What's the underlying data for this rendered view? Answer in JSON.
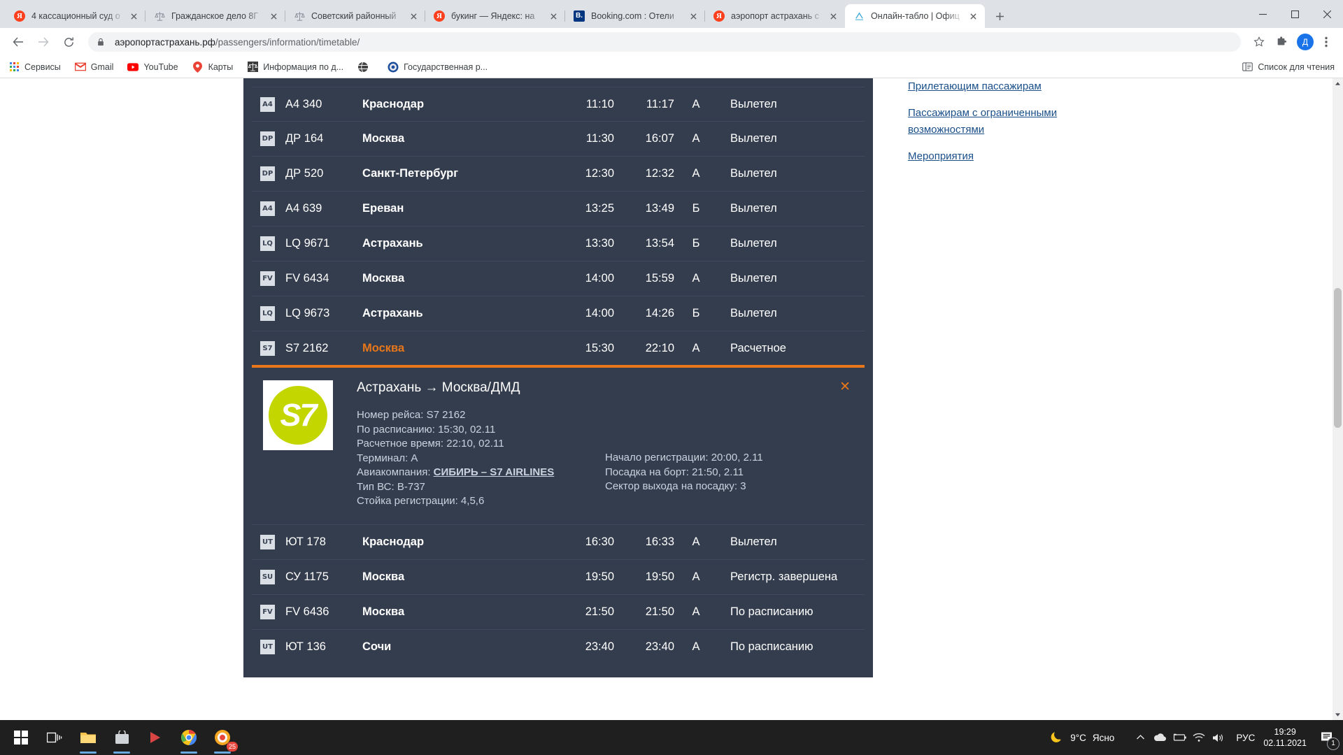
{
  "browser": {
    "tabs": [
      {
        "title": "4 кассационный суд о",
        "favicon": "yandex-icon",
        "active": false
      },
      {
        "title": "Гражданское дело 8Г",
        "favicon": "scales-icon",
        "active": false
      },
      {
        "title": "Советский районный",
        "favicon": "scales-icon",
        "active": false
      },
      {
        "title": "букинг — Яндекс: на",
        "favicon": "yandex-icon",
        "active": false
      },
      {
        "title": "Booking.com : Отели",
        "favicon": "booking-icon",
        "active": false
      },
      {
        "title": "аэропорт астрахань с",
        "favicon": "yandex-icon",
        "active": false
      },
      {
        "title": "Онлайн-табло | Офиц",
        "favicon": "airport-logo-icon",
        "active": true
      }
    ],
    "address": {
      "scheme_host": "аэропортастрахань.рф",
      "path": "/passengers/information/timetable/"
    },
    "bookmarks": [
      {
        "label": "Сервисы",
        "icon": "apps-grid-icon"
      },
      {
        "label": "Gmail",
        "icon": "gmail-icon"
      },
      {
        "label": "YouTube",
        "icon": "youtube-icon"
      },
      {
        "label": "Карты",
        "icon": "maps-pin-icon"
      },
      {
        "label": "Информация по д...",
        "icon": "scales-icon"
      },
      {
        "label": "",
        "icon": "globe-icon"
      },
      {
        "label": "Государственная р...",
        "icon": "emblem-icon"
      }
    ],
    "reading_list_label": "Список для чтения",
    "profile_initial": "Д"
  },
  "board": {
    "selected_flight_number": "S7 2162",
    "rows": [
      {
        "airline_code": "A4",
        "number": "A4 340",
        "destination": "Краснодар",
        "scheduled": "11:10",
        "estimated": "11:17",
        "terminal": "А",
        "status": "Вылетел",
        "highlight": false
      },
      {
        "airline_code": "DP",
        "number": "ДР 164",
        "destination": "Москва",
        "scheduled": "11:30",
        "estimated": "16:07",
        "terminal": "А",
        "status": "Вылетел",
        "highlight": false
      },
      {
        "airline_code": "DP",
        "number": "ДР 520",
        "destination": "Санкт-Петербург",
        "scheduled": "12:30",
        "estimated": "12:32",
        "terminal": "А",
        "status": "Вылетел",
        "highlight": false
      },
      {
        "airline_code": "A4",
        "number": "A4 639",
        "destination": "Ереван",
        "scheduled": "13:25",
        "estimated": "13:49",
        "terminal": "Б",
        "status": "Вылетел",
        "highlight": false
      },
      {
        "airline_code": "LQ",
        "number": "LQ 9671",
        "destination": "Астрахань",
        "scheduled": "13:30",
        "estimated": "13:54",
        "terminal": "Б",
        "status": "Вылетел",
        "highlight": false
      },
      {
        "airline_code": "FV",
        "number": "FV 6434",
        "destination": "Москва",
        "scheduled": "14:00",
        "estimated": "15:59",
        "terminal": "А",
        "status": "Вылетел",
        "highlight": false
      },
      {
        "airline_code": "LQ",
        "number": "LQ 9673",
        "destination": "Астрахань",
        "scheduled": "14:00",
        "estimated": "14:26",
        "terminal": "Б",
        "status": "Вылетел",
        "highlight": false
      },
      {
        "airline_code": "S7",
        "number": "S7 2162",
        "destination": "Москва",
        "scheduled": "15:30",
        "estimated": "22:10",
        "terminal": "А",
        "status": "Расчетное",
        "highlight": true
      },
      {
        "airline_code": "UT",
        "number": "ЮТ 178",
        "destination": "Краснодар",
        "scheduled": "16:30",
        "estimated": "16:33",
        "terminal": "А",
        "status": "Вылетел",
        "highlight": false
      },
      {
        "airline_code": "SU",
        "number": "СУ 1175",
        "destination": "Москва",
        "scheduled": "19:50",
        "estimated": "19:50",
        "terminal": "А",
        "status": "Регистр. завершена",
        "highlight": false
      },
      {
        "airline_code": "FV",
        "number": "FV 6436",
        "destination": "Москва",
        "scheduled": "21:50",
        "estimated": "21:50",
        "terminal": "А",
        "status": "По расписанию",
        "highlight": false
      },
      {
        "airline_code": "UT",
        "number": "ЮТ 136",
        "destination": "Сочи",
        "scheduled": "23:40",
        "estimated": "23:40",
        "terminal": "А",
        "status": "По расписанию",
        "highlight": false
      }
    ],
    "detail": {
      "route": "Астрахань → Москва/ДМД",
      "logo_text": "S7",
      "left": [
        "Номер рейса: S7 2162",
        "По расписанию: 15:30, 02.11",
        "Расчетное время: 22:10, 02.11",
        "Терминал: А"
      ],
      "airline_label": "Авиакомпания:",
      "airline_link": "СИБИРЬ – S7 AIRLINES",
      "aircraft": "Тип ВС: B-737",
      "checkin_desk": "Стойка регистрации: 4,5,6",
      "right": [
        "Начало регистрации: 20:00, 2.11",
        "Посадка на борт: 21:50, 2.11",
        "Сектор выхода на посадку: 3"
      ],
      "close_label": "✕"
    }
  },
  "sidebar": {
    "links": [
      "Прилетающим пассажирам",
      "Пассажирам с ограниченными возможностями",
      "Мероприятия"
    ]
  },
  "taskbar": {
    "weather": {
      "temp": "9°C",
      "condition": "Ясно",
      "icon": "moon-icon"
    },
    "language": "РУС",
    "time": "19:29",
    "date": "02.11.2021",
    "notification_count": "1",
    "chrome_badge": "25"
  },
  "colors": {
    "board_bg": "#343d4d",
    "accent_orange": "#e8761a",
    "link_blue": "#1a4f8a",
    "s7_green": "#c3d600"
  }
}
